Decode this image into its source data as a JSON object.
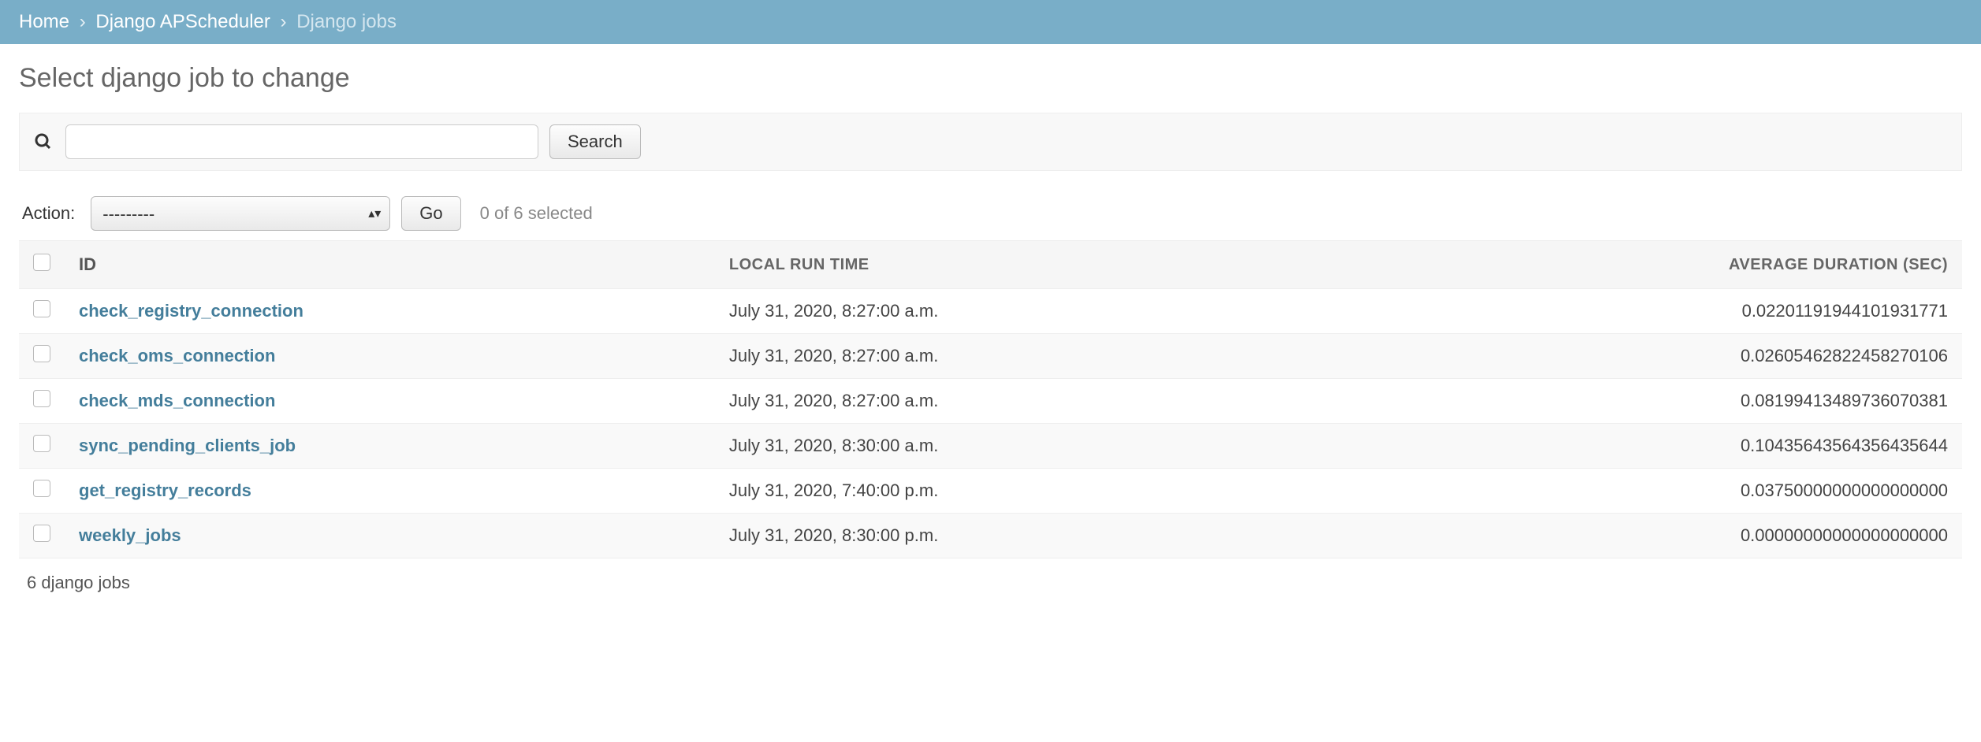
{
  "breadcrumb": {
    "home": "Home",
    "sep": "›",
    "app": "Django APScheduler",
    "current": "Django jobs"
  },
  "page_title": "Select django job to change",
  "search": {
    "value": "",
    "button": "Search"
  },
  "actions": {
    "label": "Action:",
    "selected": "---------",
    "go": "Go",
    "selection_count": "0 of 6 selected"
  },
  "table": {
    "headers": {
      "id": "ID",
      "local_run_time": "LOCAL RUN TIME",
      "avg_duration": "AVERAGE DURATION (SEC)"
    },
    "rows": [
      {
        "id": "check_registry_connection",
        "time": "July 31, 2020, 8:27:00 a.m.",
        "avg": "0.02201191944101931771"
      },
      {
        "id": "check_oms_connection",
        "time": "July 31, 2020, 8:27:00 a.m.",
        "avg": "0.02605462822458270106"
      },
      {
        "id": "check_mds_connection",
        "time": "July 31, 2020, 8:27:00 a.m.",
        "avg": "0.08199413489736070381"
      },
      {
        "id": "sync_pending_clients_job",
        "time": "July 31, 2020, 8:30:00 a.m.",
        "avg": "0.10435643564356435644"
      },
      {
        "id": "get_registry_records",
        "time": "July 31, 2020, 7:40:00 p.m.",
        "avg": "0.03750000000000000000"
      },
      {
        "id": "weekly_jobs",
        "time": "July 31, 2020, 8:30:00 p.m.",
        "avg": "0.00000000000000000000"
      }
    ]
  },
  "footer_count": "6 django jobs"
}
